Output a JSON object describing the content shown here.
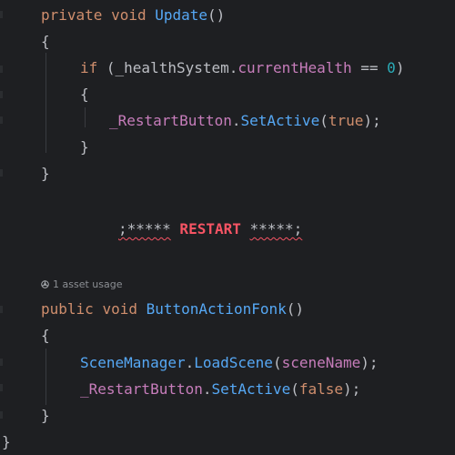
{
  "code": {
    "l1": {
      "private": "private",
      "void": "void",
      "name": "Update",
      "paren": "()"
    },
    "l2": {
      "brace": "{"
    },
    "l3": {
      "if": "if",
      "open": " (",
      "obj": "_healthSystem",
      "dot": ".",
      "field": "currentHealth",
      "op": " == ",
      "num": "0",
      "close": ")"
    },
    "l4": {
      "brace": "{"
    },
    "l5": {
      "obj": "_RestartButton",
      "dot": ".",
      "meth": "SetActive",
      "open": "(",
      "val": "true",
      "close": ");"
    },
    "l6": {
      "brace": "}"
    },
    "l7": {
      "brace": "}"
    },
    "restart_line": {
      "prefix": ";*****",
      "word": " RESTART ",
      "suffix": "*****;"
    },
    "hint": {
      "text": "1 asset usage",
      "icon": "unity-icon"
    },
    "l9": {
      "public": "public",
      "void": "void",
      "name": "ButtonActionFonk",
      "paren": "()"
    },
    "l10": {
      "brace": "{"
    },
    "l11": {
      "cls": "SceneManager",
      "dot": ".",
      "meth": "LoadScene",
      "open": "(",
      "arg": "sceneName",
      "close": ");"
    },
    "l12": {
      "obj": "_RestartButton",
      "dot": ".",
      "meth": "SetActive",
      "open": "(",
      "val": "false",
      "close": ");"
    },
    "l13": {
      "brace": "}"
    },
    "l14": {
      "brace": "}"
    }
  },
  "colors": {
    "background": "#1e1f22",
    "keyword": "#cf8e6d",
    "method": "#56a8f5",
    "field": "#c77dbb",
    "number": "#2aacb8",
    "error": "#f75464",
    "default": "#bcbec4"
  }
}
